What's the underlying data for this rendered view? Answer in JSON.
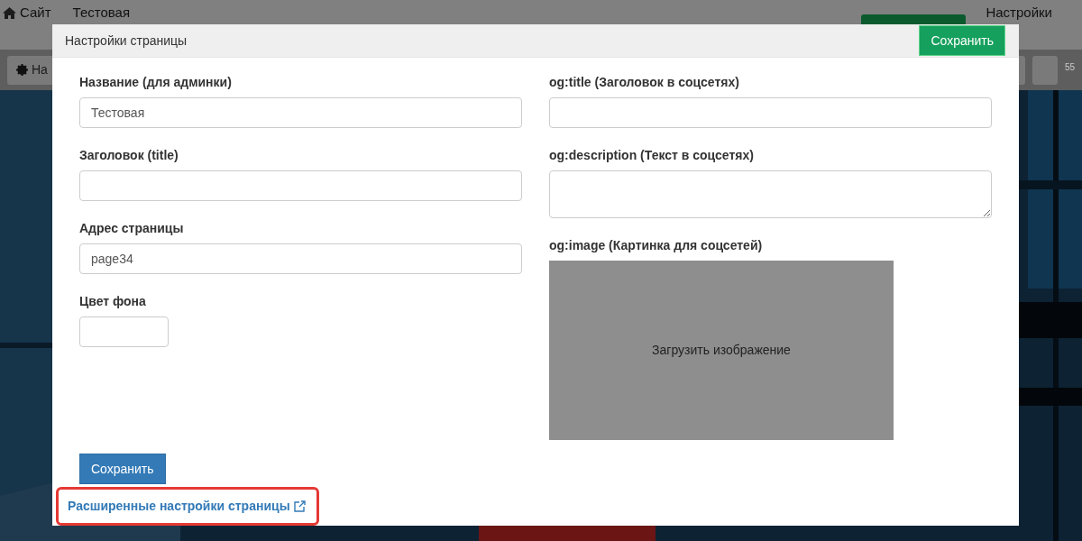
{
  "backdrop": {
    "breadcrumb": [
      {
        "label": "Сайт"
      },
      {
        "label": "Тестовая"
      }
    ],
    "settings_link": "Настройки",
    "toolbar_button": "На",
    "counter": "55"
  },
  "modal": {
    "title": "Настройки страницы",
    "header_button": "Сохранить",
    "left_fields": [
      {
        "label": "Название (для админки)",
        "value": "Тестовая",
        "kind": "input"
      },
      {
        "label": "Заголовок (title)",
        "kind": "input"
      },
      {
        "label": "Адрес страницы",
        "value": "page34",
        "kind": "input"
      },
      {
        "label": "Цвет фона",
        "kind": "color"
      }
    ],
    "right_fields": [
      {
        "label": "og:title (Заголовок в соцсетях)",
        "kind": "input"
      },
      {
        "label": "og:description (Текст в соцсетях)",
        "kind": "textarea"
      },
      {
        "label": "og:image (Картинка для соцсетей)",
        "button": "Загрузить изображение"
      }
    ],
    "save_button": "Сохранить",
    "advanced_link": {
      "label": "Расширенные настройки страницы",
      "highlighted": true
    }
  }
}
